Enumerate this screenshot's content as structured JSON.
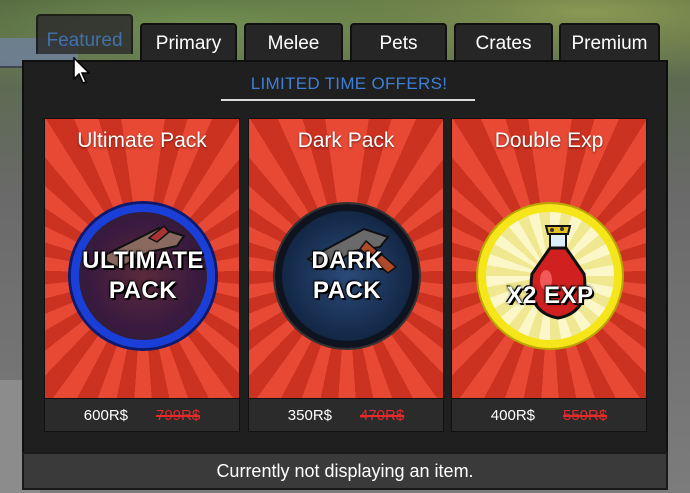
{
  "tabs": [
    {
      "label": "Featured"
    },
    {
      "label": "Primary"
    },
    {
      "label": "Melee"
    },
    {
      "label": "Pets"
    },
    {
      "label": "Crates"
    },
    {
      "label": "Premium"
    }
  ],
  "banner": "LIMITED TIME OFFERS!",
  "cards": [
    {
      "title": "Ultimate Pack",
      "emblem_line1": "ULTIMATE",
      "emblem_line2": "PACK",
      "price": "600R$",
      "old_price": "799R$",
      "ring_color": "#1a3fd9"
    },
    {
      "title": "Dark Pack",
      "emblem_line1": "DARK",
      "emblem_line2": "PACK",
      "price": "350R$",
      "old_price": "470R$",
      "ring_color": "#0d1420"
    },
    {
      "title": "Double Exp",
      "emblem_line1": "",
      "emblem_line2": "X2 EXP",
      "price": "400R$",
      "old_price": "550R$",
      "ring_color": "#f5e61a"
    }
  ],
  "status": "Currently not displaying an item.",
  "colors": {
    "card_red": "#de3e2c",
    "banner_blue": "#3e7fd6",
    "old_price_red": "#e52a2a"
  }
}
